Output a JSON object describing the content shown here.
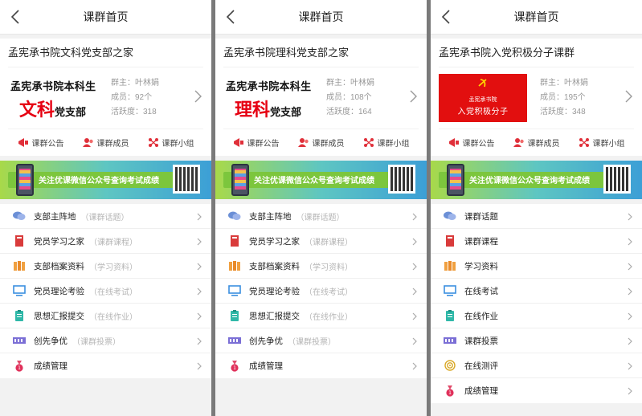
{
  "panels": [
    {
      "nav_title": "课群首页",
      "group_name": "孟宪承书院文科党支部之家",
      "logo": {
        "type": "text",
        "top": "孟宪承书院本科生",
        "big": "文科",
        "small": "党支部"
      },
      "owner": "群主：叶林娟",
      "members": "成员：92个",
      "activity": "活跃度：318",
      "actions": [
        "课群公告",
        "课群成员",
        "课群小组"
      ],
      "banner_text": "关注优课微信公众号查询考试成绩",
      "menu": [
        {
          "icon": "chat-icon",
          "label": "支部主阵地",
          "sub": "（课群话题）"
        },
        {
          "icon": "book-icon",
          "label": "党员学习之家",
          "sub": "（课群课程）"
        },
        {
          "icon": "folder-icon",
          "label": "支部档案资料",
          "sub": "（学习资料）"
        },
        {
          "icon": "monitor-icon",
          "label": "党员理论考验",
          "sub": "（在线考试）"
        },
        {
          "icon": "clipboard-icon",
          "label": "思想汇报提交",
          "sub": "（在线作业）"
        },
        {
          "icon": "ticket-icon",
          "label": "创先争优",
          "sub": "（课群投票）"
        },
        {
          "icon": "medal-icon",
          "label": "成绩管理",
          "sub": ""
        }
      ]
    },
    {
      "nav_title": "课群首页",
      "group_name": "孟宪承书院理科党支部之家",
      "logo": {
        "type": "text",
        "top": "孟宪承书院本科生",
        "big": "理科",
        "small": "党支部"
      },
      "owner": "群主：叶林娟",
      "members": "成员：108个",
      "activity": "活跃度：164",
      "actions": [
        "课群公告",
        "课群成员",
        "课群小组"
      ],
      "banner_text": "关注优课微信公众号查询考试成绩",
      "menu": [
        {
          "icon": "chat-icon",
          "label": "支部主阵地",
          "sub": "（课群话题）"
        },
        {
          "icon": "book-icon",
          "label": "党员学习之家",
          "sub": "（课群课程）"
        },
        {
          "icon": "folder-icon",
          "label": "支部档案资料",
          "sub": "（学习资料）"
        },
        {
          "icon": "monitor-icon",
          "label": "党员理论考验",
          "sub": "（在线考试）"
        },
        {
          "icon": "clipboard-icon",
          "label": "思想汇报提交",
          "sub": "（在线作业）"
        },
        {
          "icon": "ticket-icon",
          "label": "创先争优",
          "sub": "（课群投票）"
        },
        {
          "icon": "medal-icon",
          "label": "成绩管理",
          "sub": ""
        }
      ]
    },
    {
      "nav_title": "课群首页",
      "group_name": "孟宪承书院入党积极分子课群",
      "logo": {
        "type": "flag",
        "line1": "孟宪承书院",
        "line2": "入党积极分子"
      },
      "owner": "群主：叶林娟",
      "members": "成员：195个",
      "activity": "活跃度：348",
      "actions": [
        "课群公告",
        "课群成员",
        "课群小组"
      ],
      "banner_text": "关注优课微信公众号查询考试成绩",
      "menu": [
        {
          "icon": "chat-icon",
          "label": "课群话题",
          "sub": ""
        },
        {
          "icon": "book-icon",
          "label": "课群课程",
          "sub": ""
        },
        {
          "icon": "folder-icon",
          "label": "学习资料",
          "sub": ""
        },
        {
          "icon": "monitor-icon",
          "label": "在线考试",
          "sub": ""
        },
        {
          "icon": "clipboard-icon",
          "label": "在线作业",
          "sub": ""
        },
        {
          "icon": "ticket-icon",
          "label": "课群投票",
          "sub": ""
        },
        {
          "icon": "target-icon",
          "label": "在线测评",
          "sub": ""
        },
        {
          "icon": "medal-icon",
          "label": "成绩管理",
          "sub": ""
        }
      ]
    }
  ],
  "colors": {
    "accent_red": "#e60012",
    "icon_blue": "#3b8fe0",
    "icon_purple": "#7b6fd6",
    "icon_orange": "#f0a040"
  }
}
